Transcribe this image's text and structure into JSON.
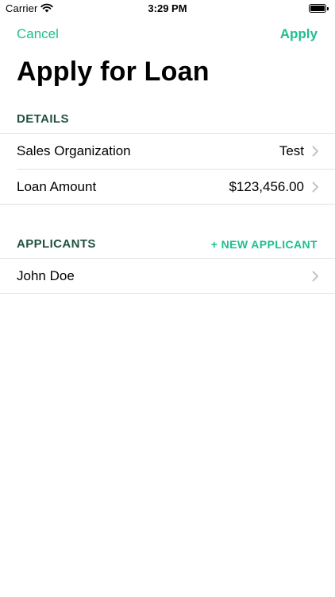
{
  "status_bar": {
    "carrier": "Carrier",
    "time": "3:29 PM"
  },
  "nav": {
    "cancel_label": "Cancel",
    "apply_label": "Apply",
    "title": "Apply for Loan"
  },
  "details": {
    "header": "DETAILS",
    "rows": [
      {
        "label": "Sales Organization",
        "value": "Test"
      },
      {
        "label": "Loan Amount",
        "value": "$123,456.00"
      }
    ]
  },
  "applicants": {
    "header": "APPLICANTS",
    "new_label": "+ NEW APPLICANT",
    "items": [
      {
        "name": "John Doe"
      }
    ]
  },
  "colors": {
    "accent": "#1fbf8f",
    "section_header": "#21523f",
    "separator": "#e3e3e6",
    "chevron": "#c4c4c7"
  },
  "icons": [
    "wifi-icon",
    "battery-icon",
    "chevron-right-icon"
  ]
}
